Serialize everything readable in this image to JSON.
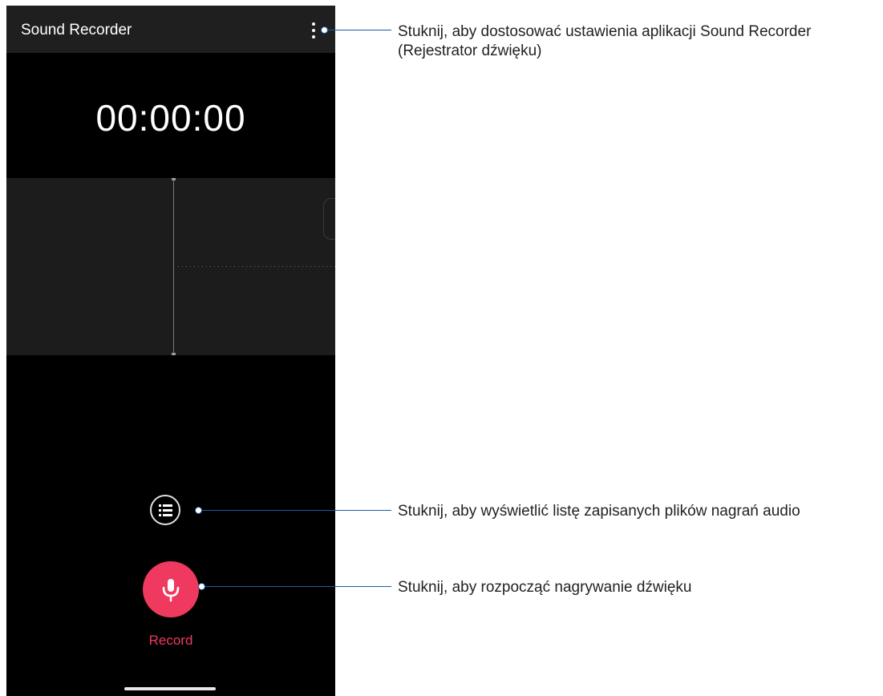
{
  "app": {
    "title": "Sound Recorder",
    "timer": "00:00:00",
    "record_label": "Record"
  },
  "icons": {
    "menu": "more-vert-icon",
    "list": "list-icon",
    "mic": "microphone-icon"
  },
  "colors": {
    "accent": "#f0395e",
    "app_bar": "#1f1f1f",
    "background": "#000000",
    "callout_line": "#1e5aa0"
  },
  "callouts": {
    "settings": "Stuknij, aby dostosować ustawienia aplikacji Sound Recorder (Rejestrator dźwięku)",
    "list": "Stuknij, aby wyświetlić listę zapisanych plików nagrań audio",
    "record": "Stuknij, aby rozpocząć nagrywanie dźwięku"
  }
}
